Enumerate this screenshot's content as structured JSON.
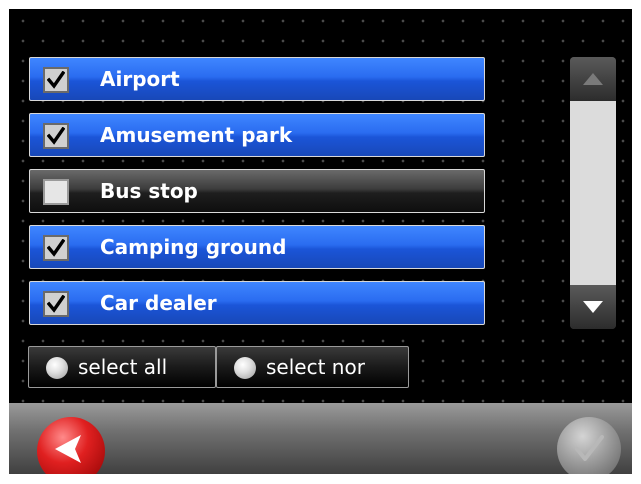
{
  "poi_list": {
    "items": [
      {
        "label": "Airport",
        "checked": true
      },
      {
        "label": "Amusement park",
        "checked": true
      },
      {
        "label": "Bus stop",
        "checked": false
      },
      {
        "label": "Camping ground",
        "checked": true
      },
      {
        "label": "Car dealer",
        "checked": true
      }
    ]
  },
  "actions": {
    "select_all_label": "select all",
    "select_none_label": "select nor"
  },
  "icons": {
    "scroll_up": "triangle-up-icon",
    "scroll_down": "triangle-down-icon",
    "back": "back-arrow-icon",
    "confirm": "checkmark-icon",
    "checkbox": "checkmark-icon"
  },
  "colors": {
    "item_checked": "#2a6cf0",
    "item_unchecked": "#2c2c2c",
    "back_button": "#e02020",
    "confirm_button": "#9c9c9c"
  }
}
